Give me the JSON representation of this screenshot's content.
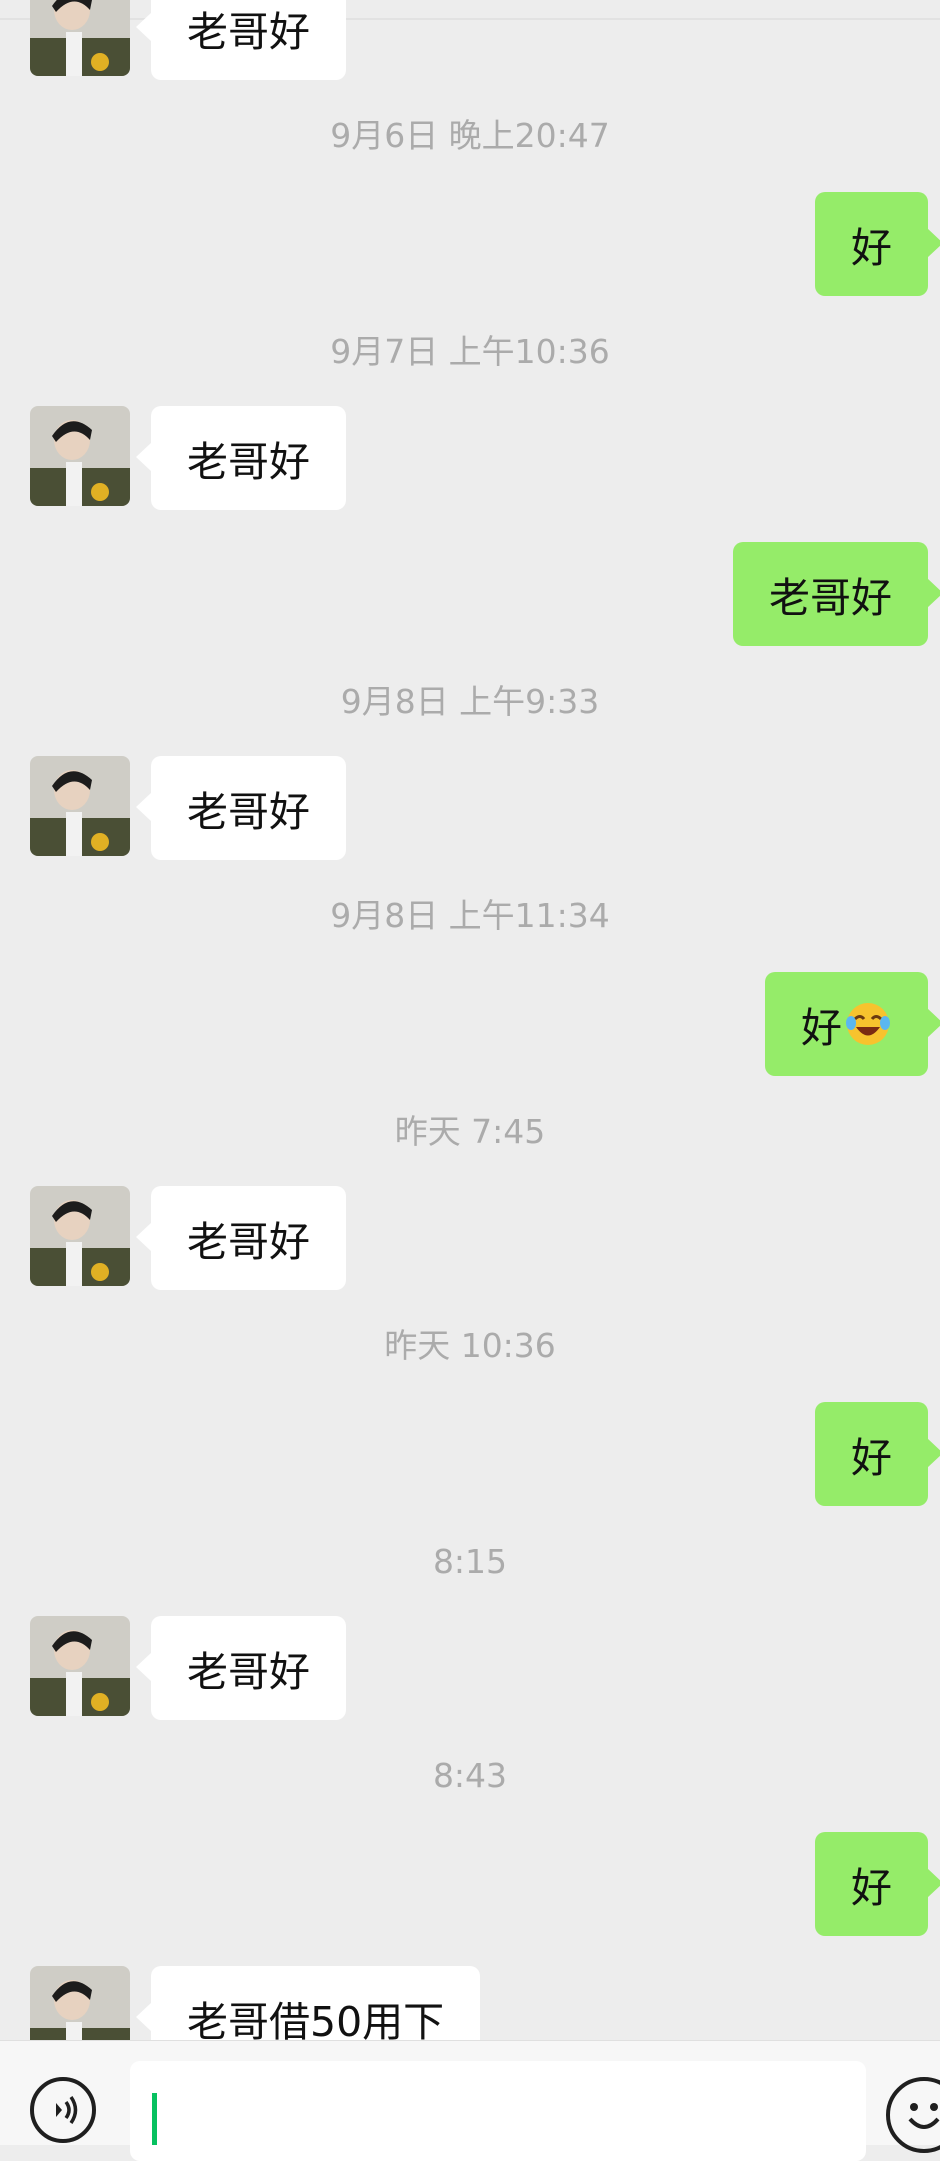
{
  "messages": [
    {
      "dir": "in",
      "text": "老哥好",
      "avatar": "avatar-photo"
    },
    {
      "timestamp": "9月6日 晚上20:47"
    },
    {
      "dir": "out",
      "text": "好"
    },
    {
      "timestamp": "9月7日 上午10:36"
    },
    {
      "dir": "in",
      "text": "老哥好",
      "avatar": "avatar-photo"
    },
    {
      "dir": "out",
      "text": "老哥好"
    },
    {
      "timestamp": "9月8日 上午9:33"
    },
    {
      "dir": "in",
      "text": "老哥好",
      "avatar": "avatar-photo"
    },
    {
      "timestamp": "9月8日 上午11:34"
    },
    {
      "dir": "out",
      "text": "好",
      "emoji": "crying-laughing-face-emoji"
    },
    {
      "timestamp": "昨天 7:45"
    },
    {
      "dir": "in",
      "text": "老哥好",
      "avatar": "avatar-photo"
    },
    {
      "timestamp": "昨天 10:36"
    },
    {
      "dir": "out",
      "text": "好"
    },
    {
      "timestamp": "8:15"
    },
    {
      "dir": "in",
      "text": "老哥好",
      "avatar": "avatar-photo"
    },
    {
      "timestamp": "8:43"
    },
    {
      "dir": "out",
      "text": "好"
    },
    {
      "dir": "in",
      "text": "老哥借50用下",
      "avatar": "avatar-photo"
    }
  ],
  "input_bar": {
    "voice_icon": "voice-icon",
    "input_value": "",
    "emoji_icon": "emoji-face-icon"
  },
  "colors": {
    "background": "#ededed",
    "incoming_bubble": "#ffffff",
    "outgoing_bubble": "#95ec69",
    "timestamp_text": "#ababab",
    "caret": "#07c160"
  }
}
